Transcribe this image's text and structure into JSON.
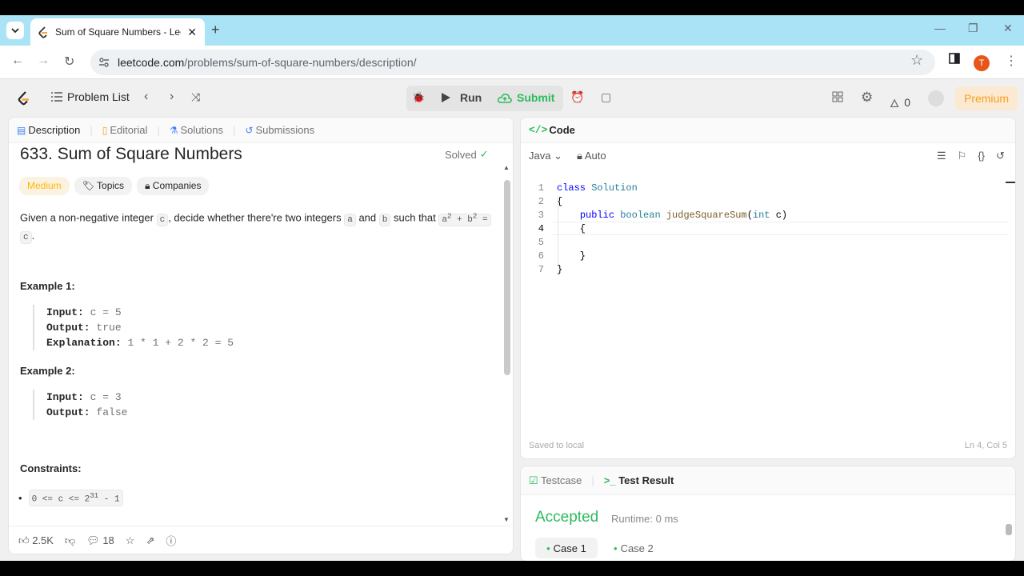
{
  "browser": {
    "tab_title": "Sum of Square Numbers - LeetCode",
    "url_host": "leetcode.com",
    "url_path": "/problems/sum-of-square-numbers/description/",
    "profile_initial": "T"
  },
  "nav": {
    "problem_list": "Problem List",
    "run": "Run",
    "submit": "Submit",
    "streak": "0",
    "premium": "Premium"
  },
  "left": {
    "tabs": [
      "Description",
      "Editorial",
      "Solutions",
      "Submissions"
    ],
    "title": "633. Sum of Square Numbers",
    "solved": "Solved",
    "difficulty": "Medium",
    "topics": "Topics",
    "companies": "Companies",
    "desc_1": "Given a non-negative integer",
    "desc_c": "c",
    "desc_2": ", decide whether there're two integers",
    "desc_a": "a",
    "desc_and": "and",
    "desc_b": "b",
    "desc_3": "such that",
    "desc_formula_a": "a",
    "desc_formula_plus": "+ b",
    "desc_formula_eq": "=",
    "desc_sup": "2",
    "desc_c2": "c",
    "desc_end": ".",
    "ex1_heading": "Example 1:",
    "ex1_input_label": "Input:",
    "ex1_input": "c = 5",
    "ex1_output_label": "Output:",
    "ex1_output": "true",
    "ex1_expl_label": "Explanation:",
    "ex1_expl": "1 * 1 + 2 * 2 = 5",
    "ex2_heading": "Example 2:",
    "ex2_input_label": "Input:",
    "ex2_input": "c = 3",
    "ex2_output_label": "Output:",
    "ex2_output": "false",
    "constraints_heading": "Constraints:",
    "constraint_1a": "0 <= c <= 2",
    "constraint_1sup": "31",
    "constraint_1b": "- 1",
    "likes": "2.5K",
    "comments": "18"
  },
  "editor": {
    "header": "Code",
    "language": "Java",
    "mode": "Auto",
    "lines": [
      "class Solution",
      "{",
      "    public boolean judgeSquareSum(int c)",
      "    {",
      "",
      "    }",
      "}"
    ],
    "saved": "Saved to local",
    "cursor": "Ln 4, Col 5"
  },
  "bottom": {
    "tab_testcase": "Testcase",
    "tab_result": "Test Result",
    "status": "Accepted",
    "runtime": "Runtime: 0 ms",
    "case1": "Case 1",
    "case2": "Case 2"
  },
  "colors": {
    "accepted": "#2cbb5d",
    "medium": "#ffb800",
    "submit": "#2cbb5d",
    "tabstrip": "#abe3f6"
  }
}
